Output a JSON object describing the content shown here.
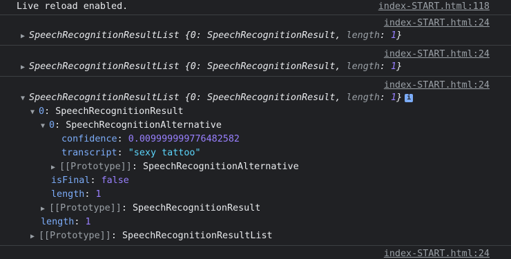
{
  "log1": {
    "text": "Live reload enabled.",
    "source": "index-START.html:118"
  },
  "log2": {
    "source": "index-START.html:24",
    "name": "SpeechRecognitionResultList",
    "preview_open": "{0: ",
    "preview_type": "SpeechRecognitionResult",
    "preview_mid": ", ",
    "preview_key": "length",
    "preview_colon": ": ",
    "preview_val": "1",
    "preview_close": "}"
  },
  "log3": {
    "source": "index-START.html:24",
    "name": "SpeechRecognitionResultList",
    "preview_open": "{0: ",
    "preview_type": "SpeechRecognitionResult",
    "preview_mid": ", ",
    "preview_key": "length",
    "preview_colon": ": ",
    "preview_val": "1",
    "preview_close": "}"
  },
  "log4": {
    "source": "index-START.html:24",
    "name": "SpeechRecognitionResultList",
    "preview_open": "{0: ",
    "preview_type": "SpeechRecognitionResult",
    "preview_mid": ", ",
    "preview_key": "length",
    "preview_colon": ": ",
    "preview_val": "1",
    "preview_close": "}",
    "info_label": "i",
    "tree": {
      "item0_key": "0",
      "item0_type": "SpeechRecognitionResult",
      "alt0_key": "0",
      "alt0_type": "SpeechRecognitionAlternative",
      "confidence_key": "confidence",
      "confidence_val": "0.009999999776482582",
      "transcript_key": "transcript",
      "transcript_val": "\"sexy tattoo\"",
      "alt_proto_key": "[[Prototype]]",
      "alt_proto_val": "SpeechRecognitionAlternative",
      "isfinal_key": "isFinal",
      "isfinal_val": "false",
      "result_length_key": "length",
      "result_length_val": "1",
      "result_proto_key": "[[Prototype]]",
      "result_proto_val": "SpeechRecognitionResult",
      "list_length_key": "length",
      "list_length_val": "1",
      "list_proto_key": "[[Prototype]]",
      "list_proto_val": "SpeechRecognitionResultList"
    }
  },
  "log5": {
    "source": "index-START.html:24"
  },
  "colon": ": "
}
